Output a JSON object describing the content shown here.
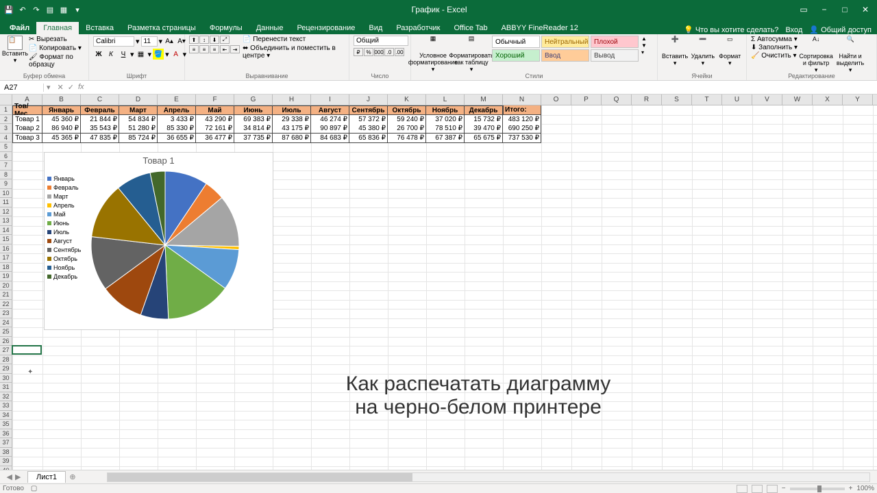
{
  "app": {
    "title": "График - Excel"
  },
  "tabs": {
    "file": "Файл",
    "items": [
      "Главная",
      "Вставка",
      "Разметка страницы",
      "Формулы",
      "Данные",
      "Рецензирование",
      "Вид",
      "Разработчик",
      "Office Tab",
      "ABBYY FineReader 12"
    ],
    "active": 0,
    "tell_me": "Что вы хотите сделать?",
    "sign_in": "Вход",
    "share": "Общий доступ"
  },
  "ribbon": {
    "clipboard": {
      "paste": "Вставить",
      "cut": "Вырезать",
      "copy": "Копировать",
      "format_painter": "Формат по образцу",
      "label": "Буфер обмена"
    },
    "font": {
      "name": "Calibri",
      "size": "11",
      "label": "Шрифт"
    },
    "align": {
      "wrap": "Перенести текст",
      "merge": "Объединить и поместить в центре",
      "label": "Выравнивание"
    },
    "number": {
      "format": "Общий",
      "label": "Число"
    },
    "cond_format": "Условное форматирование",
    "as_table": "Форматировать как таблицу",
    "styles": {
      "items": [
        {
          "name": "Обычный",
          "bg": "#ffffff",
          "color": "#000"
        },
        {
          "name": "Нейтральный",
          "bg": "#ffeb9c",
          "color": "#9c6500"
        },
        {
          "name": "Плохой",
          "bg": "#ffc7ce",
          "color": "#9c0006"
        },
        {
          "name": "Хороший",
          "bg": "#c6efce",
          "color": "#006100"
        },
        {
          "name": "Ввод",
          "bg": "#ffcc99",
          "color": "#3f3f76"
        },
        {
          "name": "Вывод",
          "bg": "#f2f2f2",
          "color": "#3f3f3f"
        }
      ],
      "label": "Стили"
    },
    "cells": {
      "insert": "Вставить",
      "delete": "Удалить",
      "format": "Формат",
      "label": "Ячейки"
    },
    "editing": {
      "autosum": "Автосумма",
      "fill": "Заполнить",
      "clear": "Очистить",
      "sort": "Сортировка и фильтр",
      "find": "Найти и выделить",
      "label": "Редактирование"
    }
  },
  "namebox": "A27",
  "fx": "fx",
  "col_widths": {
    "A": 44,
    "B": 56,
    "C": 56,
    "D": 56,
    "E": 56,
    "F": 56,
    "G": 56,
    "H": 56,
    "I": 56,
    "J": 56,
    "K": 56,
    "L": 56,
    "M": 56,
    "N": 56,
    "rest": 44
  },
  "columns": [
    "A",
    "B",
    "C",
    "D",
    "E",
    "F",
    "G",
    "H",
    "I",
    "J",
    "K",
    "L",
    "M",
    "N",
    "O",
    "P",
    "Q",
    "R",
    "S",
    "T",
    "U",
    "V",
    "W",
    "X",
    "Y"
  ],
  "table": {
    "header": [
      "Тов/Мес",
      "Январь",
      "Февраль",
      "Март",
      "Апрель",
      "Май",
      "Июнь",
      "Июль",
      "Август",
      "Сентябрь",
      "Октябрь",
      "Ноябрь",
      "Декабрь",
      "Итого:"
    ],
    "rows": [
      [
        "Товар 1",
        "45 360 ₽",
        "21 844 ₽",
        "54 834 ₽",
        "3 433 ₽",
        "43 290 ₽",
        "69 383 ₽",
        "29 338 ₽",
        "46 274 ₽",
        "57 372 ₽",
        "59 240 ₽",
        "37 020 ₽",
        "15 732 ₽",
        "483 120 ₽"
      ],
      [
        "Товар 2",
        "86 940 ₽",
        "35 543 ₽",
        "51 280 ₽",
        "85 330 ₽",
        "72 161 ₽",
        "34 814 ₽",
        "43 175 ₽",
        "90 897 ₽",
        "45 380 ₽",
        "26 700 ₽",
        "78 510 ₽",
        "39 470 ₽",
        "690 250 ₽"
      ],
      [
        "Товар 3",
        "45 365 ₽",
        "47 835 ₽",
        "85 724 ₽",
        "36 655 ₽",
        "36 477 ₽",
        "37 735 ₽",
        "87 680 ₽",
        "84 683 ₽",
        "65 836 ₽",
        "76 478 ₽",
        "67 387 ₽",
        "65 675 ₽",
        "737 530 ₽"
      ]
    ]
  },
  "chart_data": {
    "type": "pie",
    "title": "Товар 1",
    "categories": [
      "Январь",
      "Февраль",
      "Март",
      "Апрель",
      "Май",
      "Июнь",
      "Июль",
      "Август",
      "Сентябрь",
      "Октябрь",
      "Ноябрь",
      "Декабрь"
    ],
    "values": [
      45360,
      21844,
      54834,
      3433,
      43290,
      69383,
      29338,
      46274,
      57372,
      59240,
      37020,
      15732
    ],
    "colors": [
      "#4472c4",
      "#ed7d31",
      "#a5a5a5",
      "#ffc000",
      "#5b9bd5",
      "#70ad47",
      "#264478",
      "#9e480e",
      "#636363",
      "#997300",
      "#255e91",
      "#43682b"
    ],
    "legend_position": "left"
  },
  "overlay": {
    "line1": "Как распечатать диаграмму",
    "line2": "на черно-белом принтере"
  },
  "sheet": {
    "name": "Лист1"
  },
  "status": {
    "ready": "Готово",
    "zoom": "100%"
  },
  "selected_cell": "A27"
}
